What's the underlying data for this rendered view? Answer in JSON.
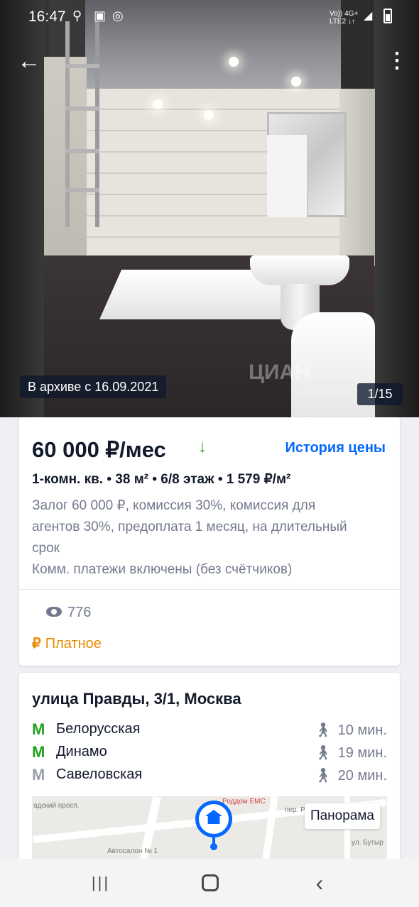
{
  "status_bar": {
    "time": "16:47",
    "network_top": "Vo)) 4G+",
    "network_bottom": "LTE2 ↓↑"
  },
  "photo": {
    "archive_label": "В архиве с 16.09.2021",
    "counter": "1/15",
    "watermark": "ЦИАН"
  },
  "listing": {
    "price": "60 000 ₽/мес",
    "price_trend": "↓",
    "price_history_label": "История цены",
    "specs": "1-комн. кв.  •  38 м²  •  6/8 этаж  •  1 579 ₽/м²",
    "terms": "Залог 60 000 ₽, комиссия 30%, комиссия для агентов 30%, предоплата 1 месяц, на длительный срок",
    "utilities": "Комм. платежи включены (без счётчиков)",
    "views": "776",
    "paid_label": "Платное"
  },
  "location": {
    "address": "улица Правды, 3/1, Москва",
    "metro": [
      {
        "name": "Белорусская",
        "time": "10 мин.",
        "color": "#1fa31f"
      },
      {
        "name": "Динамо",
        "time": "19 мин.",
        "color": "#1fa31f"
      },
      {
        "name": "Савеловская",
        "time": "20 мин.",
        "color": "#9aa0ab"
      }
    ],
    "map": {
      "panorama_label": "Панорама",
      "label_1": "Автосалон № 1",
      "label_2": "Роддом ЕМС",
      "label_3": "адский просп.",
      "label_4": "пер. Раск",
      "label_5": "ул. Бутыр"
    }
  },
  "colors": {
    "accent": "#0468ff",
    "paid": "#e98b00",
    "text": "#121a2b",
    "muted": "#737a8e"
  }
}
